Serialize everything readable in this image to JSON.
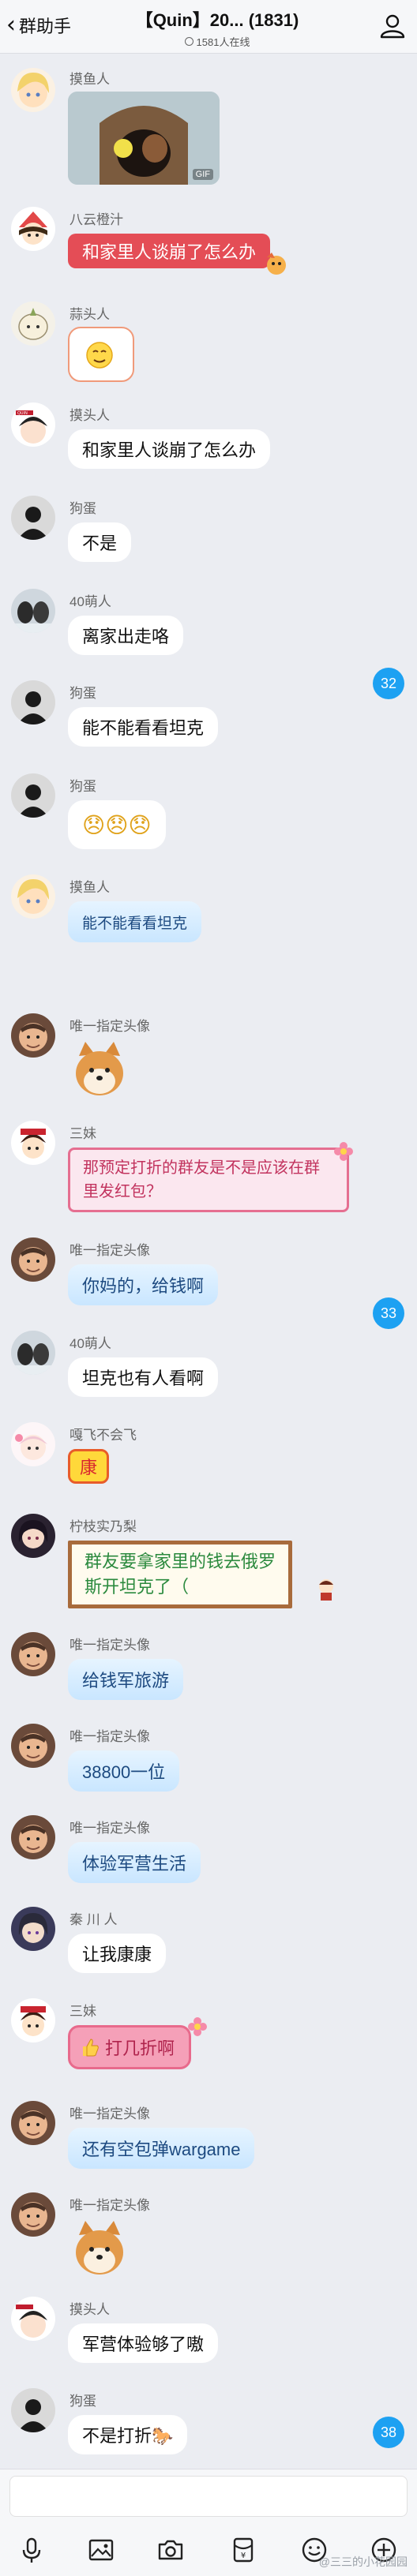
{
  "header": {
    "back_label": "群助手",
    "title": "【Quin】20... (1831)",
    "online": "1581人在线"
  },
  "messages": [
    {
      "sender": "摸鱼人",
      "type": "sticker",
      "sticker_label": "GIF"
    },
    {
      "sender": "八云橙汁",
      "text": "和家里人谈崩了怎么办"
    },
    {
      "sender": "蒜头人",
      "type": "emoji"
    },
    {
      "sender": "摸头人",
      "text": "和家里人谈崩了怎么办"
    },
    {
      "sender": "狗蛋",
      "text": "不是"
    },
    {
      "sender": "40萌人",
      "text": "离家出走咯"
    },
    {
      "sender": "狗蛋",
      "text": "能不能看看坦克"
    },
    {
      "sender": "狗蛋",
      "text": "😞😞😞"
    },
    {
      "sender": "摸鱼人",
      "text": "能不能看看坦克"
    },
    {
      "sender": "唯一指定头像",
      "type": "sticker"
    },
    {
      "sender": "三妹",
      "text": "那预定打折的群友是不是应该在群里发红包？"
    },
    {
      "sender": "唯一指定头像",
      "text": "你妈的，给钱啊"
    },
    {
      "sender": "40萌人",
      "text": "坦克也有人看啊"
    },
    {
      "sender": "嘎飞不会飞",
      "text": "康"
    },
    {
      "sender": "柠枝实乃梨",
      "text": "群友要拿家里的钱去俄罗斯开坦克了（"
    },
    {
      "sender": "唯一指定头像",
      "text": "给钱军旅游"
    },
    {
      "sender": "唯一指定头像",
      "text": "38800一位"
    },
    {
      "sender": "唯一指定头像",
      "text": "体验军营生活"
    },
    {
      "sender": "秦 川 人",
      "text": "让我康康"
    },
    {
      "sender": "三妹",
      "text": "打几折啊"
    },
    {
      "sender": "唯一指定头像",
      "text": "还有空包弹wargame"
    },
    {
      "sender": "唯一指定头像",
      "type": "sticker"
    },
    {
      "sender": "摸头人",
      "text": "军营体验够了嗷"
    },
    {
      "sender": "狗蛋",
      "text": "不是打折🐎"
    }
  ],
  "badges": [
    "32",
    "33",
    "38"
  ],
  "input": {
    "placeholder": ""
  },
  "toolbar": [
    "microphone-icon",
    "image-icon",
    "camera-icon",
    "red-packet-icon",
    "emoji-icon",
    "plus-icon"
  ],
  "watermark": "@三三的小花园园",
  "colors": {
    "accent": "#1da1f2",
    "red_bubble": "#e44d56",
    "background": "#ebedf2"
  }
}
